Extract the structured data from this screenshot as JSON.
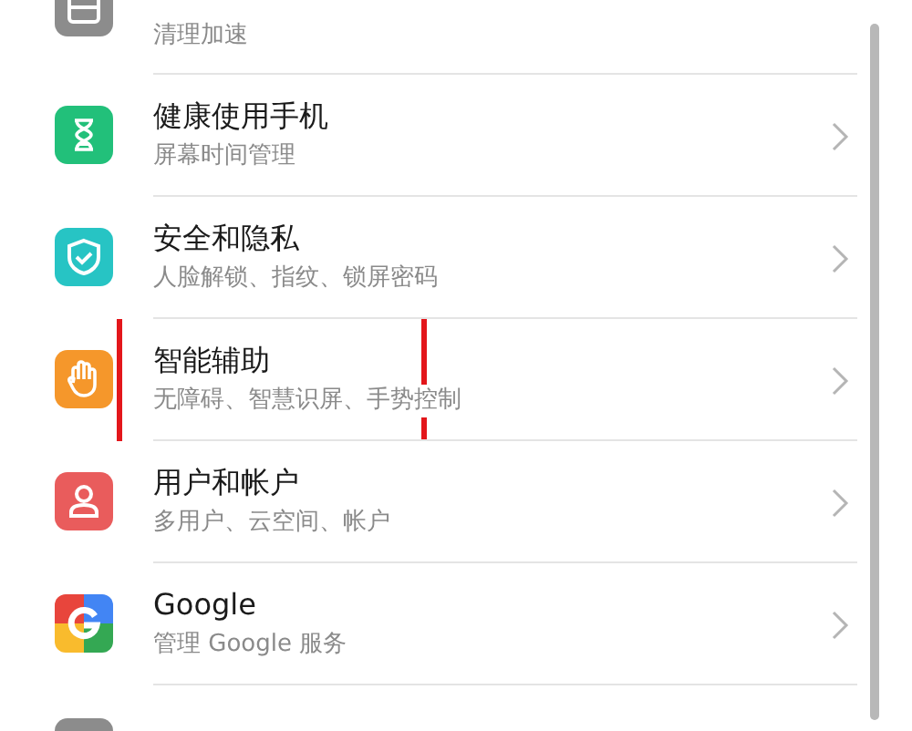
{
  "items": [
    {
      "kind": "storage",
      "subtitle": "清理加速",
      "highlighted": false
    },
    {
      "kind": "hourglass",
      "title": "健康使用手机",
      "subtitle": "屏幕时间管理",
      "highlighted": false
    },
    {
      "kind": "shield",
      "title": "安全和隐私",
      "subtitle": "人脸解锁、指纹、锁屏密码",
      "highlighted": false
    },
    {
      "kind": "hand",
      "title": "智能辅助",
      "subtitle": "无障碍、智慧识屏、手势控制",
      "highlighted": true
    },
    {
      "kind": "person",
      "title": "用户和帐户",
      "subtitle": "多用户、云空间、帐户",
      "highlighted": false
    },
    {
      "kind": "google",
      "title": "Google",
      "subtitle": "管理 Google 服务",
      "highlighted": false
    },
    {
      "kind": "system",
      "highlighted": false
    }
  ]
}
